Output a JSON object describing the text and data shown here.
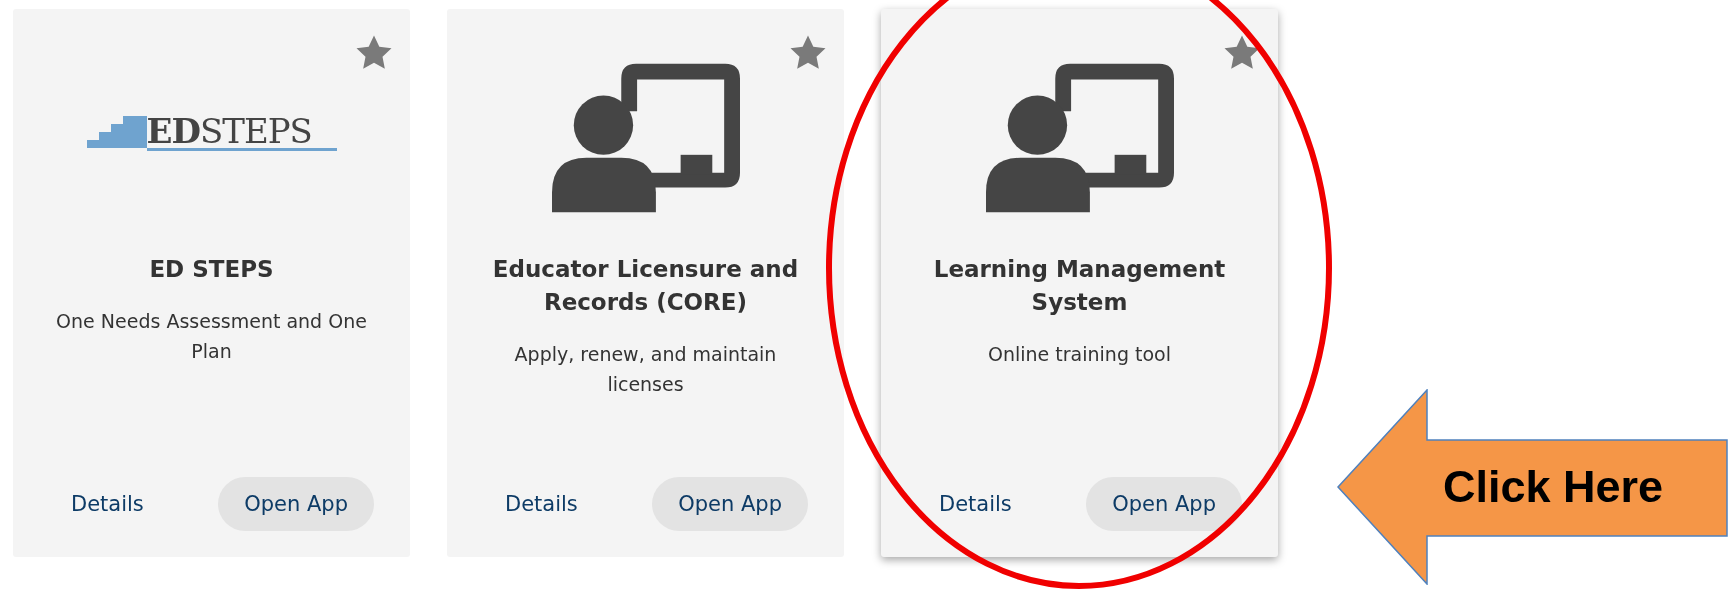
{
  "apps": [
    {
      "kind": "logo",
      "logo_text": "**ED**STEPS",
      "favorite": false,
      "raised": false,
      "highlighted": false,
      "title": "ED STEPS",
      "description": "One Needs Assessment and One Plan",
      "details_link": "Details",
      "open_button": "Open App"
    },
    {
      "kind": "presentation",
      "favorite": false,
      "raised": false,
      "highlighted": false,
      "title": "Educator Licensure and Records (CORE)",
      "description": "Apply, renew, and maintain licenses",
      "details_link": "Details",
      "open_button": "Open App"
    },
    {
      "kind": "presentation",
      "favorite": false,
      "raised": true,
      "highlighted": true,
      "title": "Learning Management System",
      "description": "Online training tool",
      "details_link": "Details",
      "open_button": "Open App"
    }
  ],
  "callout": {
    "text": "Click Here"
  }
}
